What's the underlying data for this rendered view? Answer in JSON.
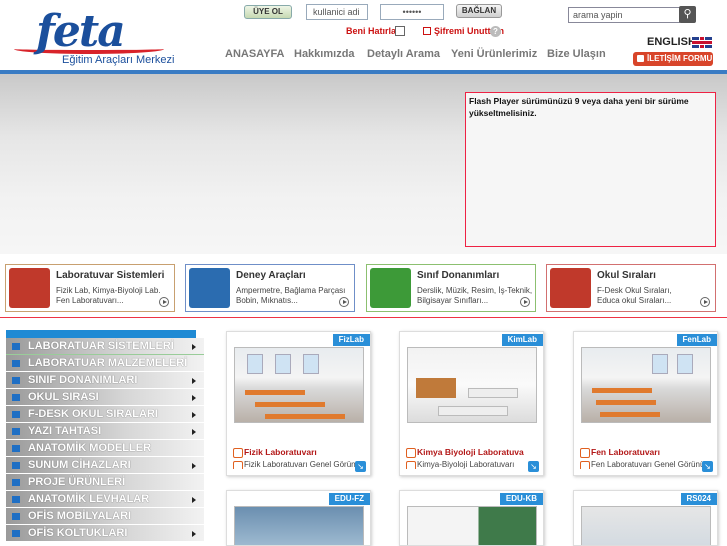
{
  "header": {
    "logo_text": "feta",
    "logo_sub": "Eğitim Araçları Merkezi",
    "signup_label": "ÜYE OL",
    "username_value": "kullanici adi",
    "password_value": "••••••",
    "login_label": "BAĞLAN",
    "remember_label": "Beni Hatırla",
    "forgot_label": "Şifremi Unuttum",
    "help_label": "?",
    "search_placeholder": "arama yapin",
    "search_icon": "search-icon",
    "language_label": "ENGLISH",
    "contact_label": "İLETİŞİM FORMU"
  },
  "nav": {
    "items": [
      "ANASAYFA",
      "Hakkımızda",
      "Detaylı Arama",
      "Yeni Ürünlerimiz",
      "Bize Ulaşın"
    ]
  },
  "hero": {
    "flash_message": "Flash Player sürümünüzü 9 veya daha yeni bir sürüme yükseltmelisiniz."
  },
  "categories": [
    {
      "title": "Laboratuvar Sistemleri",
      "line1": "Fizik Lab, Kimya-Biyoloji Lab.",
      "line2": "Fen Laboratuvarı...",
      "border": "#c8a070",
      "icon_bg": "#c0392b"
    },
    {
      "title": "Deney Araçları",
      "line1": "Ampermetre,  Bağlama Parçası",
      "line2": "Bobin, Mıknatıs...",
      "border": "#6f8fc8",
      "icon_bg": "#2b6cb0"
    },
    {
      "title": "Sınıf Donanımları",
      "line1": "Derslik, Müzik, Resim, İş-Teknik,",
      "line2": "Bilgisayar Sınıfları...",
      "border": "#8cc070",
      "icon_bg": "#3d9a38"
    },
    {
      "title": "Okul Sıraları",
      "line1": "F-Desk Okul Sıraları,",
      "line2": "Educa okul Sıraları...",
      "border": "#d27070",
      "icon_bg": "#c0392b"
    }
  ],
  "sidebar": {
    "items": [
      {
        "label": "LABORATUAR SİSTEMLERİ",
        "arrow": true
      },
      {
        "label": "LABORATUAR MALZEMELERİ",
        "arrow": false
      },
      {
        "label": "SINIF DONANIMLARI",
        "arrow": true
      },
      {
        "label": "OKUL SIRASI",
        "arrow": true
      },
      {
        "label": "F-DESK OKUL SIRALARI",
        "arrow": true
      },
      {
        "label": "YAZI TAHTASI",
        "arrow": true
      },
      {
        "label": "ANATOMİK MODELLER",
        "arrow": false
      },
      {
        "label": "SUNUM CİHAZLARI",
        "arrow": true
      },
      {
        "label": "PROJE ÜRÜNLERİ",
        "arrow": false
      },
      {
        "label": "ANATOMİK LEVHALAR",
        "arrow": true
      },
      {
        "label": "OFİS MOBİLYALARI",
        "arrow": false
      },
      {
        "label": "OFİS KOLTUKLARI",
        "arrow": true
      }
    ]
  },
  "products": [
    {
      "tag": "FizLab",
      "title": "Fizik Laboratuvarı",
      "desc": "Fizik Laboratuvarı Genel Görünüm"
    },
    {
      "tag": "KimLab",
      "title": "Kimya Biyoloji Laboratuva",
      "desc": "Kimya-Biyoloji Laboratuvarı"
    },
    {
      "tag": "FenLab",
      "title": "Fen Laboratuvarı",
      "desc": "Fen Laboratuvarı Genel Görünüm"
    }
  ],
  "products_row2": [
    {
      "tag": "EDU-FZ"
    },
    {
      "tag": "EDU-KB"
    },
    {
      "tag": "RS024"
    }
  ],
  "colors": {
    "accent_blue": "#3a7cc4",
    "accent_red": "#d8232a",
    "tag_blue": "#2a8fd8"
  }
}
